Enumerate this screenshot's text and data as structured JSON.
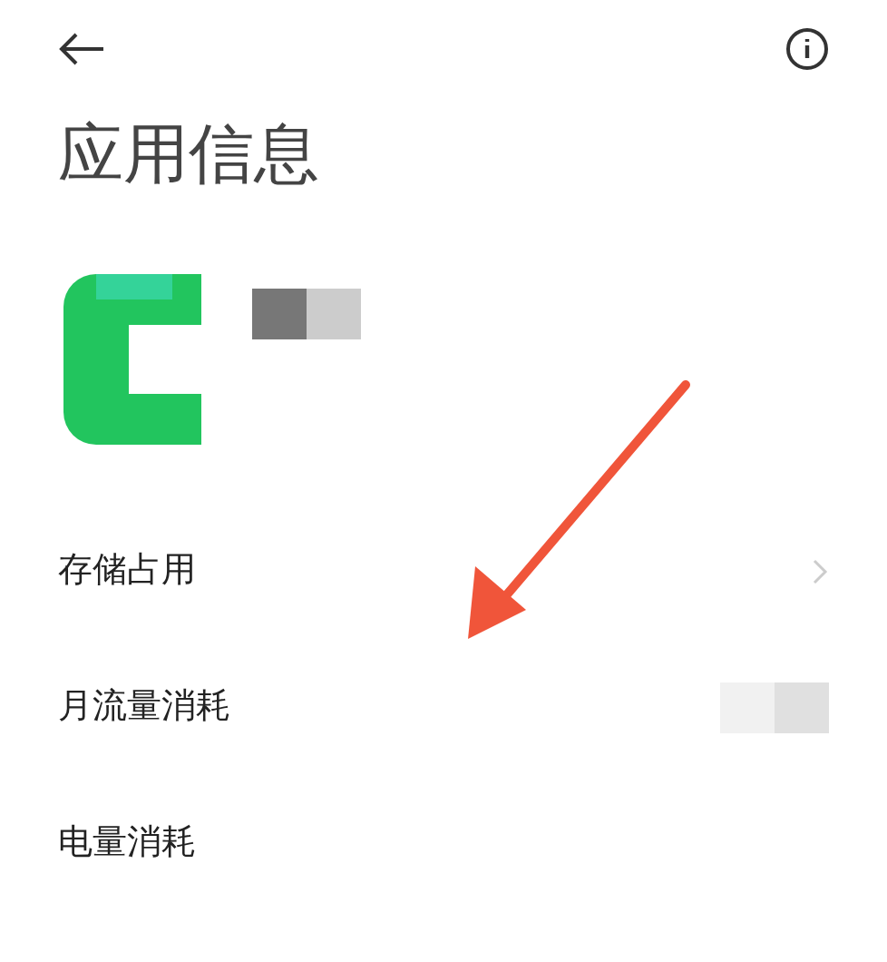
{
  "header": {
    "title": "应用信息"
  },
  "rows": [
    {
      "label": "存储占用",
      "kind": "link"
    },
    {
      "label": "月流量消耗",
      "kind": "value"
    },
    {
      "label": "电量消耗",
      "kind": "plain"
    }
  ]
}
